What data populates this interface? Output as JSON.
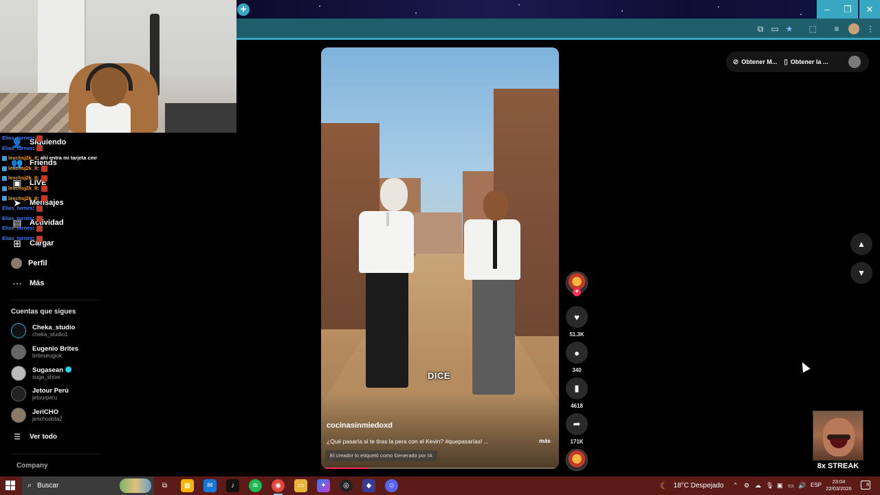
{
  "browser": {
    "new_tab_icon": "plus-icon",
    "window_controls": [
      "minimize-icon",
      "restore-icon",
      "close-icon"
    ],
    "toolbar_icons": [
      "translate-icon",
      "cast-icon",
      "bookmark-star-icon",
      "extensions-icon",
      "media-icon",
      "profile-icon",
      "menu-icon"
    ]
  },
  "sidebar": {
    "nav": [
      {
        "label": "Siguiendo",
        "icon": "following-icon"
      },
      {
        "label": "Friends",
        "icon": "friends-icon"
      },
      {
        "label": "LIVE",
        "icon": "live-icon"
      },
      {
        "label": "Mensajes",
        "icon": "messages-icon"
      },
      {
        "label": "Actividad",
        "icon": "activity-icon"
      },
      {
        "label": "Cargar",
        "icon": "upload-icon"
      },
      {
        "label": "Perfil",
        "icon": "profile-avatar"
      },
      {
        "label": "Más",
        "icon": "more-icon"
      }
    ],
    "following_title": "Cuentas que sigues",
    "accounts": [
      {
        "name": "Cheka_studio",
        "username": "cheka_studio1",
        "verified": false
      },
      {
        "name": "Eugenio Brites",
        "username": "briteseugiok",
        "verified": false
      },
      {
        "name": "Sugasean",
        "username": "suga_show",
        "verified": true
      },
      {
        "name": "Jetour Perú",
        "username": "jetourperu",
        "verified": false
      },
      {
        "name": "JeriCHO",
        "username": "jerichodota2",
        "verified": false
      }
    ],
    "see_all": "Ver todo",
    "company": "Company"
  },
  "chat": [
    {
      "user": "Elias_turnes",
      "text": ":",
      "style": "u1"
    },
    {
      "user": "Elias_turnes",
      "text": ":",
      "style": "u1"
    },
    {
      "user": "lexchsj2k_8",
      "text": ": ahí entra mi tarjeta cmr",
      "style": "u2"
    },
    {
      "user": "lexchsj2k_8",
      "text": ":",
      "style": "u2"
    },
    {
      "user": "lexchsj2k_8",
      "text": ":",
      "style": "u2"
    },
    {
      "user": "lexchsj2k_8",
      "text": ":",
      "style": "u2"
    },
    {
      "user": "lexchsj2k_8",
      "text": ":",
      "style": "u2"
    },
    {
      "user": "Elias_turnes",
      "text": ":",
      "style": "u1"
    },
    {
      "user": "Elias_turnes",
      "text": ":",
      "style": "u1"
    },
    {
      "user": "Elias_turnes",
      "text": ":",
      "style": "u1"
    },
    {
      "user": "Elias_turnes",
      "text": ":",
      "style": "u1"
    }
  ],
  "video": {
    "caption_word": "DICE",
    "username": "cocinasinmiedoxd",
    "description": "¿Qué pasaría si te tiras la pera con el Kevin? #quepasarías! ...",
    "more": "más",
    "ai_label": "El creador lo etiquetó como Generado por IA",
    "progress": 0.2
  },
  "actions": {
    "likes": "51.3K",
    "comments": "340",
    "saves": "4618",
    "shares": "171K"
  },
  "top_right": {
    "get_button_1": "Obtener M...",
    "get_button_2": "Obtener la ..."
  },
  "streak": {
    "label": "8x STREAK"
  },
  "taskbar": {
    "search_placeholder": "Buscar",
    "weather": "18°C  Despejado",
    "language": "ESP",
    "time": "23:04",
    "date": "22/03/2026",
    "notifications": "8"
  }
}
